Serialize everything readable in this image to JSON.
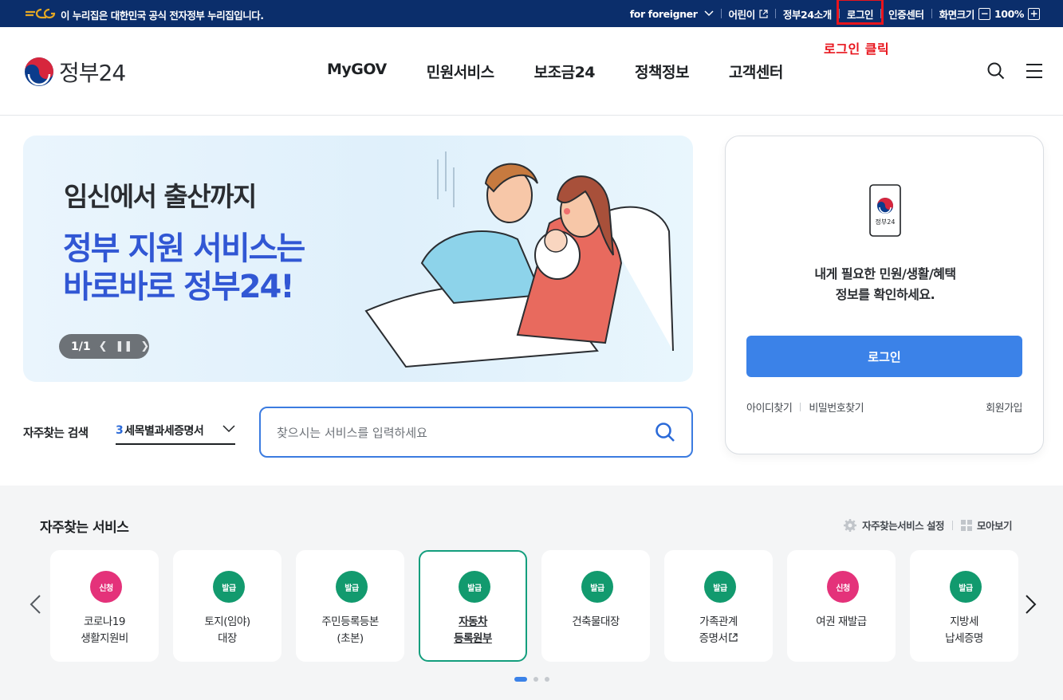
{
  "gov_bar": {
    "notice": "이 누리집은 대한민국 공식 전자정부 누리집입니다.",
    "links": [
      "for foreigner",
      "어린이",
      "정부24소개",
      "로그인",
      "인증센터",
      "화면크기"
    ],
    "zoom": "100%",
    "zoom_minus": "−",
    "zoom_plus": "+"
  },
  "annotation": "로그인 클릭",
  "header": {
    "logo": "정부24",
    "menu": [
      "MyGOV",
      "민원서비스",
      "보조금24",
      "정책정보",
      "고객센터"
    ]
  },
  "banner": {
    "subtitle": "임신에서 출산까지",
    "title_line1": "정부 지원 서비스는",
    "title_line2": "바로바로 정부24!",
    "pager": "1/1"
  },
  "search": {
    "label": "자주찾는 검색",
    "select_num": "3",
    "select_value": "세목별과세증명서",
    "placeholder": "찾으시는 서비스를 입력하세요"
  },
  "login_card": {
    "phone_label": "정부24",
    "message_line1": "내게 필요한 민원/생활/혜택",
    "message_line2": "정보를 확인하세요.",
    "button": "로그인",
    "find_id": "아이디찾기",
    "find_pw": "비밀번호찾기",
    "signup": "회원가입"
  },
  "favorites": {
    "title": "자주찾는 서비스",
    "settings": "자주찾는서비스 설정",
    "view_all": "모아보기",
    "badge_colors": {
      "신청": "#e4327a",
      "발급": "#129a6e"
    },
    "cards": [
      {
        "badge": "신청",
        "label": "코로나19\n생활지원비"
      },
      {
        "badge": "발급",
        "label": "토지(임야)\n대장"
      },
      {
        "badge": "발급",
        "label": "주민등록등본\n(초본)"
      },
      {
        "badge": "발급",
        "label": "자동차\n등록원부"
      },
      {
        "badge": "발급",
        "label": "건축물대장"
      },
      {
        "badge": "발급",
        "label": "가족관계\n증명서"
      },
      {
        "badge": "신청",
        "label": "여권 재발급"
      },
      {
        "badge": "발급",
        "label": "지방세\n납세증명"
      }
    ]
  }
}
